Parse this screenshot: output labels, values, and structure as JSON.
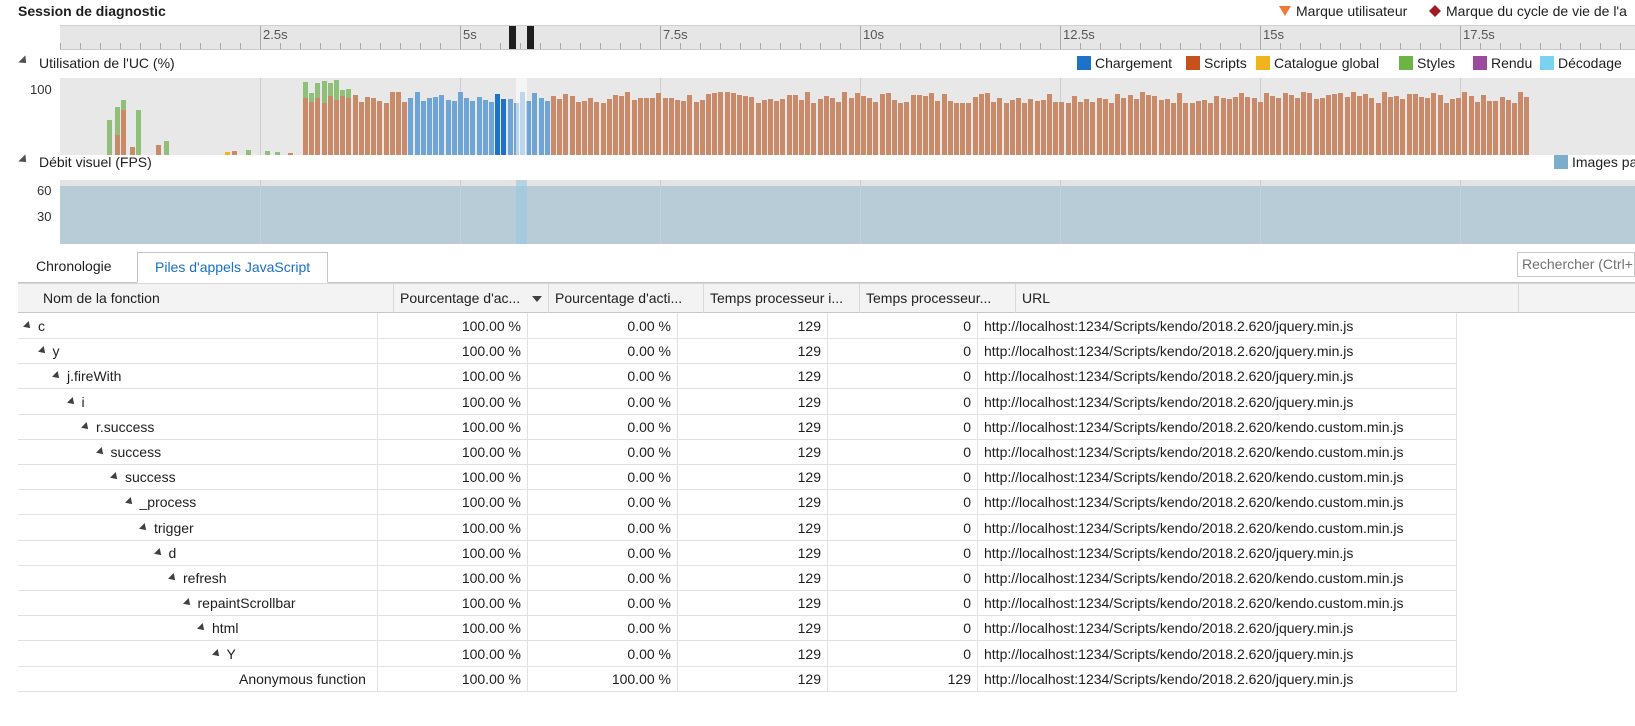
{
  "session": {
    "title": "Session de diagnostic",
    "user_mark_label": "Marque utilisateur",
    "lifecycle_mark_label": "Marque du cycle de vie de l'a",
    "user_mark_color": "#f07838",
    "lifecycle_mark_color": "#a01c24"
  },
  "ruler": {
    "ticks": [
      "2.5s",
      "5s",
      "7.5s",
      "10s",
      "12.5s",
      "15s",
      "17.5s"
    ]
  },
  "cpu": {
    "title": "Utilisation de l'UC (%)",
    "y_label": "100",
    "legend": [
      {
        "label": "Chargement",
        "color": "#1e73c8"
      },
      {
        "label": "Scripts",
        "color": "#c8501c"
      },
      {
        "label": "Catalogue global",
        "color": "#f0b41e"
      },
      {
        "label": "Styles",
        "color": "#6cb446"
      },
      {
        "label": "Rendu",
        "color": "#9b4a9b"
      },
      {
        "label": "Décodage",
        "color": "#78d2f0"
      }
    ]
  },
  "fps": {
    "title": "Débit visuel (FPS)",
    "y_labels": [
      "60",
      "30"
    ],
    "legend_label": "Images pa",
    "legend_color": "#7aaecc"
  },
  "tabs": [
    "Chronologie",
    "Piles d'appels JavaScript"
  ],
  "search": {
    "placeholder": "Rechercher (Ctrl+"
  },
  "table": {
    "headers": [
      "Nom de la fonction",
      "Pourcentage d'ac...",
      "Pourcentage d'acti...",
      "Temps processeur i...",
      "Temps processeur...",
      "URL"
    ],
    "rows": [
      {
        "name": "c",
        "depth": 0,
        "expander": true,
        "incl_pct": "100.00 %",
        "excl_pct": "0.00 %",
        "incl_time": "129",
        "excl_time": "0",
        "url": "http://localhost:1234/Scripts/kendo/2018.2.620/jquery.min.js"
      },
      {
        "name": "y",
        "depth": 1,
        "expander": true,
        "incl_pct": "100.00 %",
        "excl_pct": "0.00 %",
        "incl_time": "129",
        "excl_time": "0",
        "url": "http://localhost:1234/Scripts/kendo/2018.2.620/jquery.min.js"
      },
      {
        "name": "j.fireWith",
        "depth": 2,
        "expander": true,
        "incl_pct": "100.00 %",
        "excl_pct": "0.00 %",
        "incl_time": "129",
        "excl_time": "0",
        "url": "http://localhost:1234/Scripts/kendo/2018.2.620/jquery.min.js"
      },
      {
        "name": "i",
        "depth": 3,
        "expander": true,
        "incl_pct": "100.00 %",
        "excl_pct": "0.00 %",
        "incl_time": "129",
        "excl_time": "0",
        "url": "http://localhost:1234/Scripts/kendo/2018.2.620/jquery.min.js"
      },
      {
        "name": "r.success",
        "depth": 4,
        "expander": true,
        "incl_pct": "100.00 %",
        "excl_pct": "0.00 %",
        "incl_time": "129",
        "excl_time": "0",
        "url": "http://localhost:1234/Scripts/kendo/2018.2.620/kendo.custom.min.js"
      },
      {
        "name": "success",
        "depth": 5,
        "expander": true,
        "incl_pct": "100.00 %",
        "excl_pct": "0.00 %",
        "incl_time": "129",
        "excl_time": "0",
        "url": "http://localhost:1234/Scripts/kendo/2018.2.620/kendo.custom.min.js"
      },
      {
        "name": "success",
        "depth": 6,
        "expander": true,
        "incl_pct": "100.00 %",
        "excl_pct": "0.00 %",
        "incl_time": "129",
        "excl_time": "0",
        "url": "http://localhost:1234/Scripts/kendo/2018.2.620/kendo.custom.min.js"
      },
      {
        "name": "_process",
        "depth": 7,
        "expander": true,
        "incl_pct": "100.00 %",
        "excl_pct": "0.00 %",
        "incl_time": "129",
        "excl_time": "0",
        "url": "http://localhost:1234/Scripts/kendo/2018.2.620/kendo.custom.min.js"
      },
      {
        "name": "trigger",
        "depth": 8,
        "expander": true,
        "incl_pct": "100.00 %",
        "excl_pct": "0.00 %",
        "incl_time": "129",
        "excl_time": "0",
        "url": "http://localhost:1234/Scripts/kendo/2018.2.620/kendo.custom.min.js"
      },
      {
        "name": "d",
        "depth": 9,
        "expander": true,
        "incl_pct": "100.00 %",
        "excl_pct": "0.00 %",
        "incl_time": "129",
        "excl_time": "0",
        "url": "http://localhost:1234/Scripts/kendo/2018.2.620/jquery.min.js"
      },
      {
        "name": "refresh",
        "depth": 10,
        "expander": true,
        "incl_pct": "100.00 %",
        "excl_pct": "0.00 %",
        "incl_time": "129",
        "excl_time": "0",
        "url": "http://localhost:1234/Scripts/kendo/2018.2.620/kendo.custom.min.js"
      },
      {
        "name": "repaintScrollbar",
        "depth": 11,
        "expander": true,
        "incl_pct": "100.00 %",
        "excl_pct": "0.00 %",
        "incl_time": "129",
        "excl_time": "0",
        "url": "http://localhost:1234/Scripts/kendo/2018.2.620/kendo.custom.min.js"
      },
      {
        "name": "html",
        "depth": 12,
        "expander": true,
        "incl_pct": "100.00 %",
        "excl_pct": "0.00 %",
        "incl_time": "129",
        "excl_time": "0",
        "url": "http://localhost:1234/Scripts/kendo/2018.2.620/jquery.min.js"
      },
      {
        "name": "Y",
        "depth": 13,
        "expander": true,
        "incl_pct": "100.00 %",
        "excl_pct": "0.00 %",
        "incl_time": "129",
        "excl_time": "0",
        "url": "http://localhost:1234/Scripts/kendo/2018.2.620/jquery.min.js"
      },
      {
        "name": "Anonymous function",
        "depth": 14,
        "expander": false,
        "incl_pct": "100.00 %",
        "excl_pct": "100.00 %",
        "incl_time": "129",
        "excl_time": "129",
        "url": "http://localhost:1234/Scripts/kendo/2018.2.620/jquery.min.js"
      }
    ]
  }
}
